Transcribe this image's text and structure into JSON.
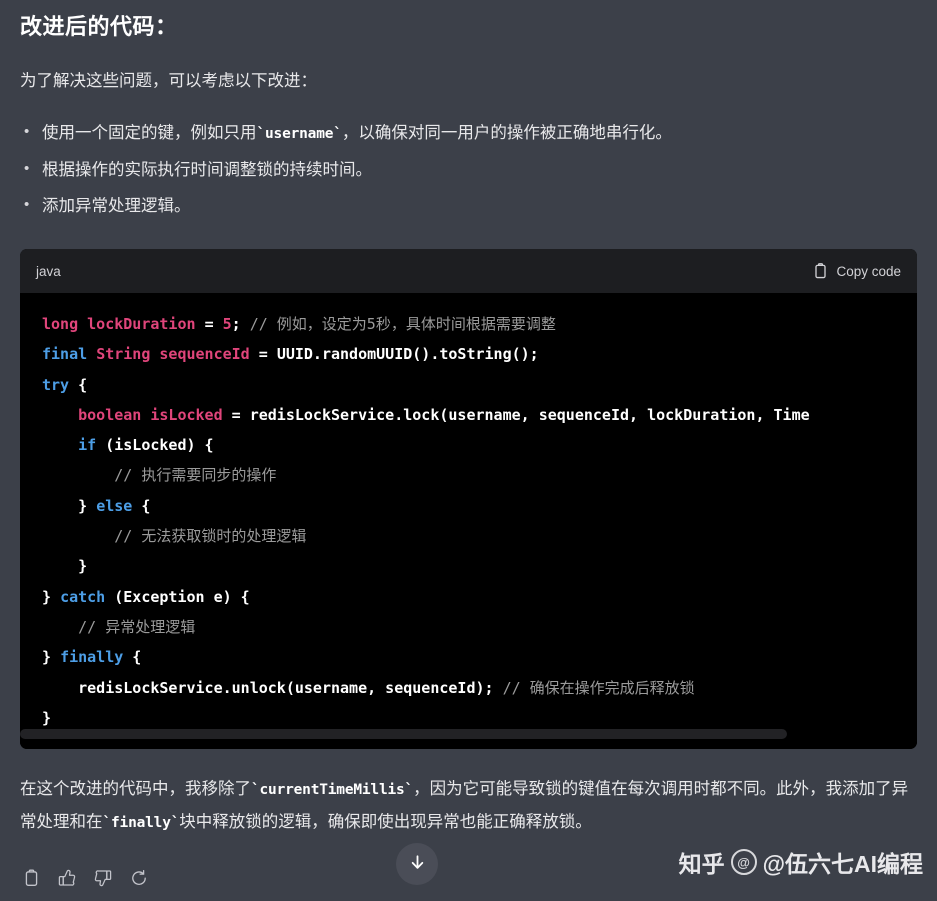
{
  "heading": "改进后的代码：",
  "intro": "为了解决这些问题，可以考虑以下改进：",
  "bullets": [
    {
      "pre": "使用一个固定的键，例如只用",
      "code": "`username`",
      "post": "，以确保对同一用户的操作被正确地串行化。"
    },
    {
      "pre": "根据操作的实际执行时间调整锁的持续时间。",
      "code": "",
      "post": ""
    },
    {
      "pre": "添加异常处理逻辑。",
      "code": "",
      "post": ""
    }
  ],
  "codeblock": {
    "language": "java",
    "copy_label": "Copy code",
    "copy_icon": "clipboard-icon",
    "scrollbar": {
      "visible": true,
      "thumb_fraction": 0.855
    },
    "lines": [
      [
        {
          "t": "long",
          "c": "typ"
        },
        {
          "t": " ",
          "c": "plain"
        },
        {
          "t": "lockDuration",
          "c": "typ"
        },
        {
          "t": " ",
          "c": "plain"
        },
        {
          "t": "=",
          "c": "plain"
        },
        {
          "t": " ",
          "c": "plain"
        },
        {
          "t": "5",
          "c": "num"
        },
        {
          "t": ";",
          "c": "plain"
        },
        {
          "t": " ",
          "c": "plain"
        },
        {
          "t": "// 例如，设定为5秒，具体时间根据需要调整",
          "c": "cmt"
        }
      ],
      [
        {
          "t": "final",
          "c": "kw"
        },
        {
          "t": " ",
          "c": "plain"
        },
        {
          "t": "String",
          "c": "typ"
        },
        {
          "t": " ",
          "c": "plain"
        },
        {
          "t": "sequenceId",
          "c": "typ"
        },
        {
          "t": " = ",
          "c": "plain"
        },
        {
          "t": "UUID.randomUUID().toString();",
          "c": "plain"
        }
      ],
      [
        {
          "t": "try",
          "c": "kw"
        },
        {
          "t": " {",
          "c": "plain"
        }
      ],
      [
        {
          "t": "    ",
          "c": "plain"
        },
        {
          "t": "boolean",
          "c": "typ"
        },
        {
          "t": " ",
          "c": "plain"
        },
        {
          "t": "isLocked",
          "c": "typ"
        },
        {
          "t": " = ",
          "c": "plain"
        },
        {
          "t": "redisLockService.lock(username, sequenceId, lockDuration, Time",
          "c": "plain"
        }
      ],
      [
        {
          "t": "    ",
          "c": "plain"
        },
        {
          "t": "if",
          "c": "kw"
        },
        {
          "t": " (isLocked) {",
          "c": "plain"
        }
      ],
      [
        {
          "t": "        ",
          "c": "plain"
        },
        {
          "t": "// 执行需要同步的操作",
          "c": "cmt"
        }
      ],
      [
        {
          "t": "    } ",
          "c": "plain"
        },
        {
          "t": "else",
          "c": "kw"
        },
        {
          "t": " {",
          "c": "plain"
        }
      ],
      [
        {
          "t": "        ",
          "c": "plain"
        },
        {
          "t": "// 无法获取锁时的处理逻辑",
          "c": "cmt"
        }
      ],
      [
        {
          "t": "    }",
          "c": "plain"
        }
      ],
      [
        {
          "t": "} ",
          "c": "plain"
        },
        {
          "t": "catch",
          "c": "kw"
        },
        {
          "t": " (Exception e) {",
          "c": "plain"
        }
      ],
      [
        {
          "t": "    ",
          "c": "plain"
        },
        {
          "t": "// 异常处理逻辑",
          "c": "cmt"
        }
      ],
      [
        {
          "t": "} ",
          "c": "plain"
        },
        {
          "t": "finally",
          "c": "kw"
        },
        {
          "t": " {",
          "c": "plain"
        }
      ],
      [
        {
          "t": "    redisLockService.unlock(username, sequenceId); ",
          "c": "plain"
        },
        {
          "t": "// 确保在操作完成后释放锁",
          "c": "cmt"
        }
      ],
      [
        {
          "t": "}",
          "c": "plain"
        }
      ]
    ]
  },
  "closing": {
    "seg1": "在这个改进的代码中，我移除了",
    "code1": "`currentTimeMillis`",
    "seg2": "，因为它可能导致锁的键值在每次调用时都不同。此外，我添加了异常处理和在",
    "code2": "`finally`",
    "seg3": "块中释放锁的逻辑，确保即使出现异常也能正确释放锁。"
  },
  "toolbar": {
    "buttons": [
      {
        "name": "copy-message-button",
        "icon": "clipboard-icon"
      },
      {
        "name": "thumbs-up-button",
        "icon": "thumbs-up-icon"
      },
      {
        "name": "thumbs-down-button",
        "icon": "thumbs-down-icon"
      },
      {
        "name": "regenerate-button",
        "icon": "refresh-icon"
      }
    ]
  },
  "scroll_fab": {
    "icon": "arrow-down-icon"
  },
  "watermark": {
    "site": "知乎",
    "logo": "@",
    "handle": "@伍六七AI编程"
  },
  "colors": {
    "page_bg": "#3c4049",
    "code_bg": "#000000",
    "code_header_bg": "#1d1e21",
    "keyword": "#4d9ee6",
    "type": "#e0457b",
    "comment": "#9b9b9b",
    "text": "#e8e8ea",
    "fab_bg": "#4a4d57"
  }
}
